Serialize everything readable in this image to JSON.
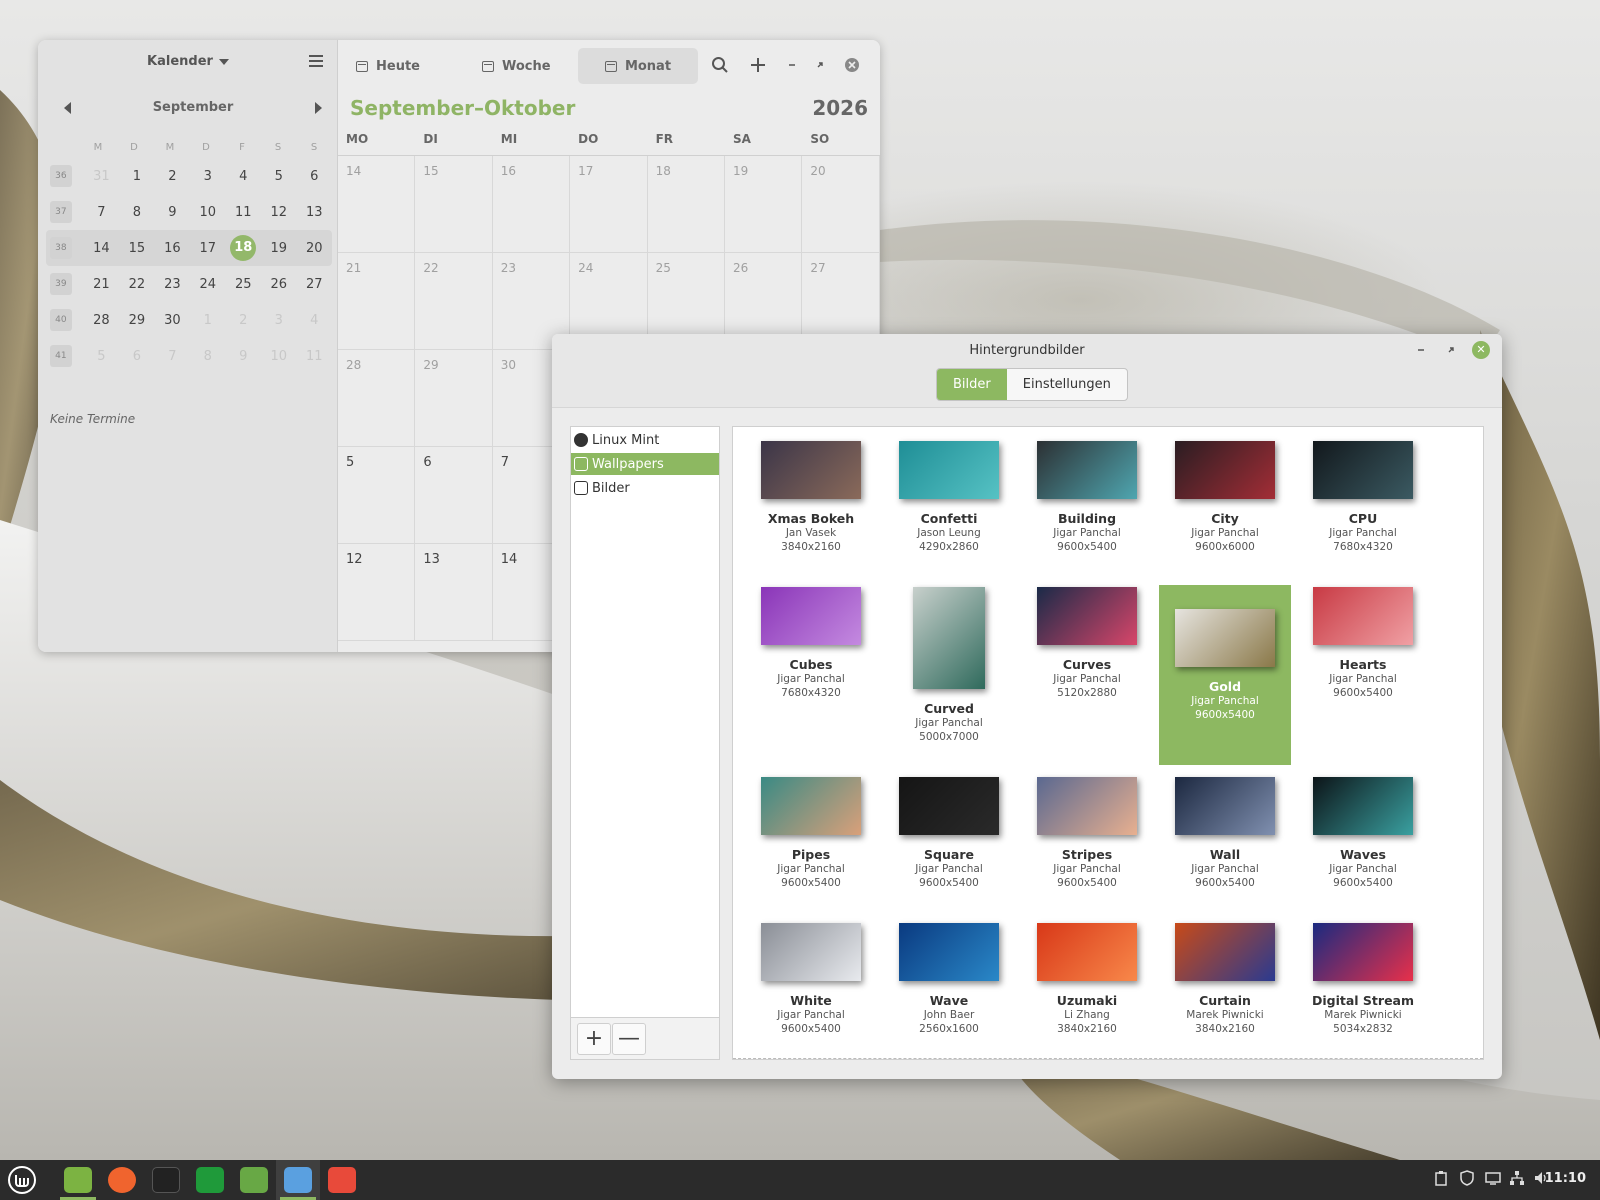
{
  "calendar": {
    "sidebar_title": "Kalender",
    "mini_month": "September",
    "weekday_initials": [
      "M",
      "D",
      "M",
      "D",
      "F",
      "S",
      "S"
    ],
    "weeks": [
      {
        "wk": "36",
        "days": [
          "31",
          "1",
          "2",
          "3",
          "4",
          "5",
          "6"
        ],
        "dim": [
          0
        ]
      },
      {
        "wk": "37",
        "days": [
          "7",
          "8",
          "9",
          "10",
          "11",
          "12",
          "13"
        ],
        "dim": []
      },
      {
        "wk": "38",
        "days": [
          "14",
          "15",
          "16",
          "17",
          "18",
          "19",
          "20"
        ],
        "dim": [],
        "current": true,
        "today_index": 4
      },
      {
        "wk": "39",
        "days": [
          "21",
          "22",
          "23",
          "24",
          "25",
          "26",
          "27"
        ],
        "dim": []
      },
      {
        "wk": "40",
        "days": [
          "28",
          "29",
          "30",
          "1",
          "2",
          "3",
          "4"
        ],
        "dim": [
          3,
          4,
          5,
          6
        ]
      },
      {
        "wk": "41",
        "days": [
          "5",
          "6",
          "7",
          "8",
          "9",
          "10",
          "11"
        ],
        "dim": [
          0,
          1,
          2,
          3,
          4,
          5,
          6
        ]
      }
    ],
    "no_events": "Keine Termine",
    "view_today": "Heute",
    "view_week": "Woche",
    "view_month": "Monat",
    "range_title": "September–Oktober",
    "year": "2026",
    "weekday_names": [
      "MO",
      "DI",
      "MI",
      "DO",
      "FR",
      "SA",
      "SO"
    ],
    "month_rows": [
      {
        "days": [
          "14",
          "15",
          "16",
          "17",
          "18",
          "19",
          "20"
        ],
        "current": false
      },
      {
        "days": [
          "21",
          "22",
          "23",
          "24",
          "25",
          "26",
          "27"
        ],
        "current": false
      },
      {
        "days": [
          "28",
          "29",
          "30",
          "",
          "",
          "",
          ""
        ],
        "current": false
      },
      {
        "days": [
          "5",
          "6",
          "7",
          "",
          "",
          "",
          ""
        ],
        "current": true
      },
      {
        "days": [
          "12",
          "13",
          "14",
          "",
          "",
          "",
          ""
        ],
        "current": true
      }
    ]
  },
  "wallpapers": {
    "title": "Hintergrundbilder",
    "tab_images": "Bilder",
    "tab_settings": "Einstellungen",
    "sources": [
      {
        "label": "Linux Mint",
        "icon": "linux-mint-icon",
        "selected": false
      },
      {
        "label": "Wallpapers",
        "icon": "image-icon",
        "selected": true
      },
      {
        "label": "Bilder",
        "icon": "image-icon",
        "selected": false
      }
    ],
    "add_label": "+",
    "remove_label": "—",
    "items": [
      {
        "name": "Xmas Bokeh",
        "author": "Jan Vasek",
        "res": "3840x2160",
        "colors": [
          "#3b3548",
          "#8a6a5a"
        ],
        "orient": "wide"
      },
      {
        "name": "Confetti",
        "author": "Jason Leung",
        "res": "4290x2860",
        "colors": [
          "#1f8e96",
          "#56c2c4"
        ],
        "orient": "wide"
      },
      {
        "name": "Building",
        "author": "Jigar Panchal",
        "res": "9600x5400",
        "colors": [
          "#2c3033",
          "#4fa6b0"
        ],
        "orient": "wide"
      },
      {
        "name": "City",
        "author": "Jigar Panchal",
        "res": "9600x6000",
        "colors": [
          "#2a1d22",
          "#a32d36"
        ],
        "orient": "wide"
      },
      {
        "name": "CPU",
        "author": "Jigar Panchal",
        "res": "7680x4320",
        "colors": [
          "#12181c",
          "#3b5a62"
        ],
        "orient": "wide"
      },
      {
        "name": "Cubes",
        "author": "Jigar Panchal",
        "res": "7680x4320",
        "colors": [
          "#8a35b8",
          "#c48ae0"
        ],
        "orient": "wide"
      },
      {
        "name": "Curved",
        "author": "Jigar Panchal",
        "res": "5000x7000",
        "colors": [
          "#c8d0cc",
          "#2f6a5c"
        ],
        "orient": "tall"
      },
      {
        "name": "Curves",
        "author": "Jigar Panchal",
        "res": "5120x2880",
        "colors": [
          "#1a2a48",
          "#d8466a"
        ],
        "orient": "wide"
      },
      {
        "name": "Gold",
        "author": "Jigar Panchal",
        "res": "9600x5400",
        "colors": [
          "#e6e4df",
          "#8a7848"
        ],
        "orient": "wide",
        "selected": true
      },
      {
        "name": "Hearts",
        "author": "Jigar Panchal",
        "res": "9600x5400",
        "colors": [
          "#c83a44",
          "#f0a0a4"
        ],
        "orient": "wide"
      },
      {
        "name": "Pipes",
        "author": "Jigar Panchal",
        "res": "9600x5400",
        "colors": [
          "#3a8a84",
          "#d9a07a"
        ],
        "orient": "wide"
      },
      {
        "name": "Square",
        "author": "Jigar Panchal",
        "res": "9600x5400",
        "colors": [
          "#151515",
          "#2a2a2a"
        ],
        "orient": "wide"
      },
      {
        "name": "Stripes",
        "author": "Jigar Panchal",
        "res": "9600x5400",
        "colors": [
          "#5a6890",
          "#e8b090"
        ],
        "orient": "wide"
      },
      {
        "name": "Wall",
        "author": "Jigar Panchal",
        "res": "9600x5400",
        "colors": [
          "#1c2840",
          "#8090b0"
        ],
        "orient": "wide"
      },
      {
        "name": "Waves",
        "author": "Jigar Panchal",
        "res": "9600x5400",
        "colors": [
          "#0c1418",
          "#3aa0a0"
        ],
        "orient": "wide"
      },
      {
        "name": "White",
        "author": "Jigar Panchal",
        "res": "9600x5400",
        "colors": [
          "#8a8e96",
          "#e8eaee"
        ],
        "orient": "wide"
      },
      {
        "name": "Wave",
        "author": "John Baer",
        "res": "2560x1600",
        "colors": [
          "#0a3a80",
          "#2a88c8"
        ],
        "orient": "wide"
      },
      {
        "name": "Uzumaki",
        "author": "Li Zhang",
        "res": "3840x2160",
        "colors": [
          "#d83818",
          "#f8884a"
        ],
        "orient": "wide"
      },
      {
        "name": "Curtain",
        "author": "Marek Piwnicki",
        "res": "3840x2160",
        "colors": [
          "#c84a18",
          "#2a3a90"
        ],
        "orient": "wide"
      },
      {
        "name": "Digital Stream",
        "author": "Marek Piwnicki",
        "res": "5034x2832",
        "colors": [
          "#1a2a80",
          "#e8304a"
        ],
        "orient": "wide"
      }
    ]
  },
  "taskbar": {
    "apps": [
      {
        "icon": "files-icon",
        "color": "#7cb342",
        "active": false
      },
      {
        "icon": "firefox-icon",
        "color": "#f0642e",
        "active": false
      },
      {
        "icon": "terminal-icon",
        "color": "#222222",
        "active": false
      },
      {
        "icon": "spreadsheet-icon",
        "color": "#1f9a3a",
        "active": false
      },
      {
        "icon": "software-manager-icon",
        "color": "#68a845",
        "active": false
      },
      {
        "icon": "wallpaper-app-icon",
        "color": "#5aa0e0",
        "active": true
      },
      {
        "icon": "calendar-app-icon",
        "color": "#e84a3a",
        "active": false
      }
    ],
    "clock": "11:10"
  }
}
